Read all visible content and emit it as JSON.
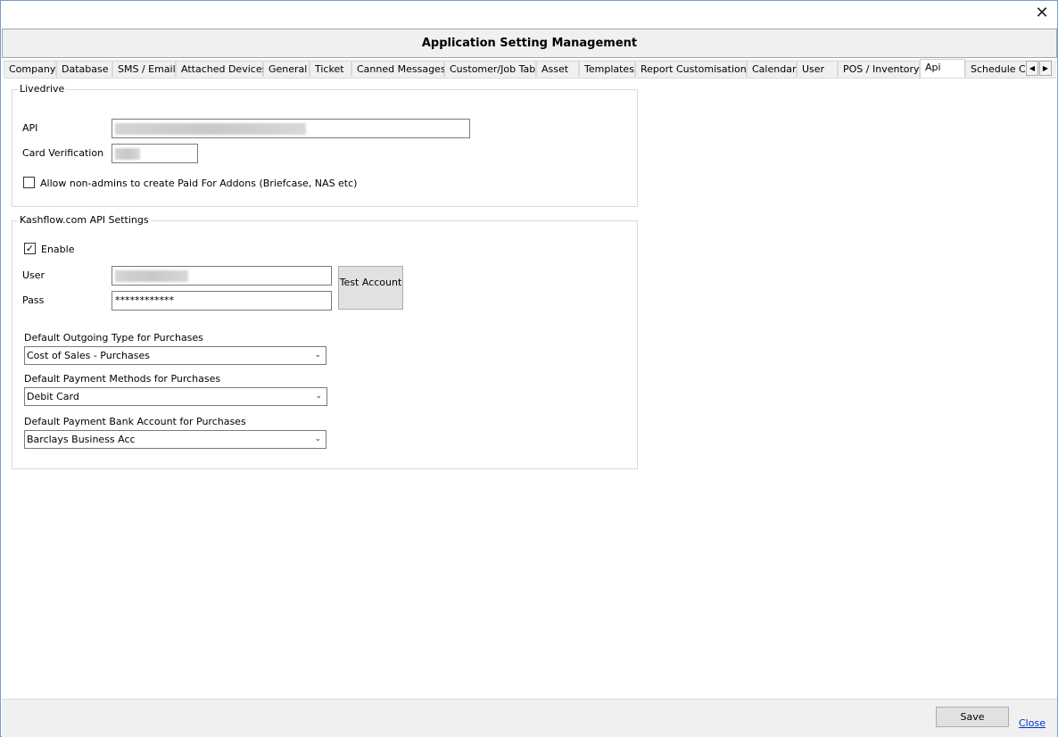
{
  "window": {
    "title": "Application Setting Management"
  },
  "tabs": [
    {
      "label": "Company"
    },
    {
      "label": "Database"
    },
    {
      "label": "SMS / Email"
    },
    {
      "label": "Attached Devices"
    },
    {
      "label": "General"
    },
    {
      "label": "Ticket"
    },
    {
      "label": "Canned Messages"
    },
    {
      "label": "Customer/Job Tab"
    },
    {
      "label": "Asset"
    },
    {
      "label": "Templates"
    },
    {
      "label": "Report Customisation"
    },
    {
      "label": "Calendar"
    },
    {
      "label": "User"
    },
    {
      "label": "POS / Inventory"
    },
    {
      "label": "Api"
    },
    {
      "label": "Schedule CR"
    }
  ],
  "active_tab": "Api",
  "livedrive": {
    "title": "Livedrive",
    "api_label": "API",
    "card_label": "Card Verification",
    "allow_label": "Allow non-admins to create Paid For Addons (Briefcase, NAS etc)",
    "allow_checked": false
  },
  "kashflow": {
    "title": "Kashflow.com API Settings",
    "enable_label": "Enable",
    "enable_checked": true,
    "user_label": "User",
    "pass_label": "Pass",
    "pass_value": "************",
    "test_button": "Test Account",
    "outgoing_label": "Default Outgoing Type for Purchases",
    "outgoing_value": "Cost of Sales - Purchases",
    "payment_label": "Default Payment Methods for Purchases",
    "payment_value": "Debit Card",
    "bank_label": "Default Payment Bank Account for Purchases",
    "bank_value": "Barclays Business Acc"
  },
  "footer": {
    "save": "Save",
    "close": "Close"
  }
}
